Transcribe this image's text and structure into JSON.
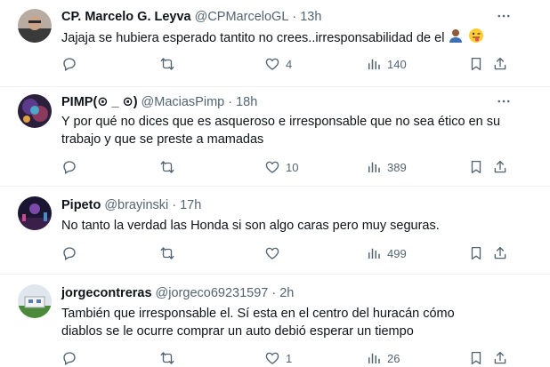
{
  "tweets": [
    {
      "name": "CP. Marcelo G. Leyva",
      "handle": "@CPMarceloGL",
      "separator": "·",
      "time": "13h",
      "text": "Jajaja se hubiera esperado tantito no crees..irresponsabilidad de el",
      "likes": "4",
      "views": "140"
    },
    {
      "name": "PIMP(⊙ _ ⊙)",
      "handle": "@MaciasPimp",
      "separator": "·",
      "time": "18h",
      "text_line1": "Y por qué no dices que es asqueroso e irresponsable que no sea ético en su",
      "text_line2": "trabajo y que se preste a mamadas",
      "likes": "10",
      "views": "389"
    },
    {
      "name": "Pipeto",
      "handle": "@brayinski",
      "separator": "·",
      "time": "17h",
      "text": "No tanto la verdad las Honda si son algo caras pero muy seguras.",
      "likes": "",
      "views": "499"
    },
    {
      "name": "jorgecontreras",
      "handle": "@jorgeco69231597",
      "separator": "·",
      "time": "2h",
      "text_line1": "También que irresponsable el. Sí esta en el centro del huracán cómo",
      "text_line2": "diablos se le ocurre comprar un auto debió esperar un tiempo",
      "likes": "1",
      "views": "26"
    }
  ],
  "icons": {
    "reply": "reply-icon",
    "retweet": "retweet-icon",
    "like": "heart-icon",
    "views": "views-icon",
    "bookmark": "bookmark-icon",
    "share": "share-icon",
    "more": "more-icon"
  },
  "colors": {
    "text": "#0f1419",
    "secondary": "#536471",
    "divider": "#eff3f4"
  }
}
